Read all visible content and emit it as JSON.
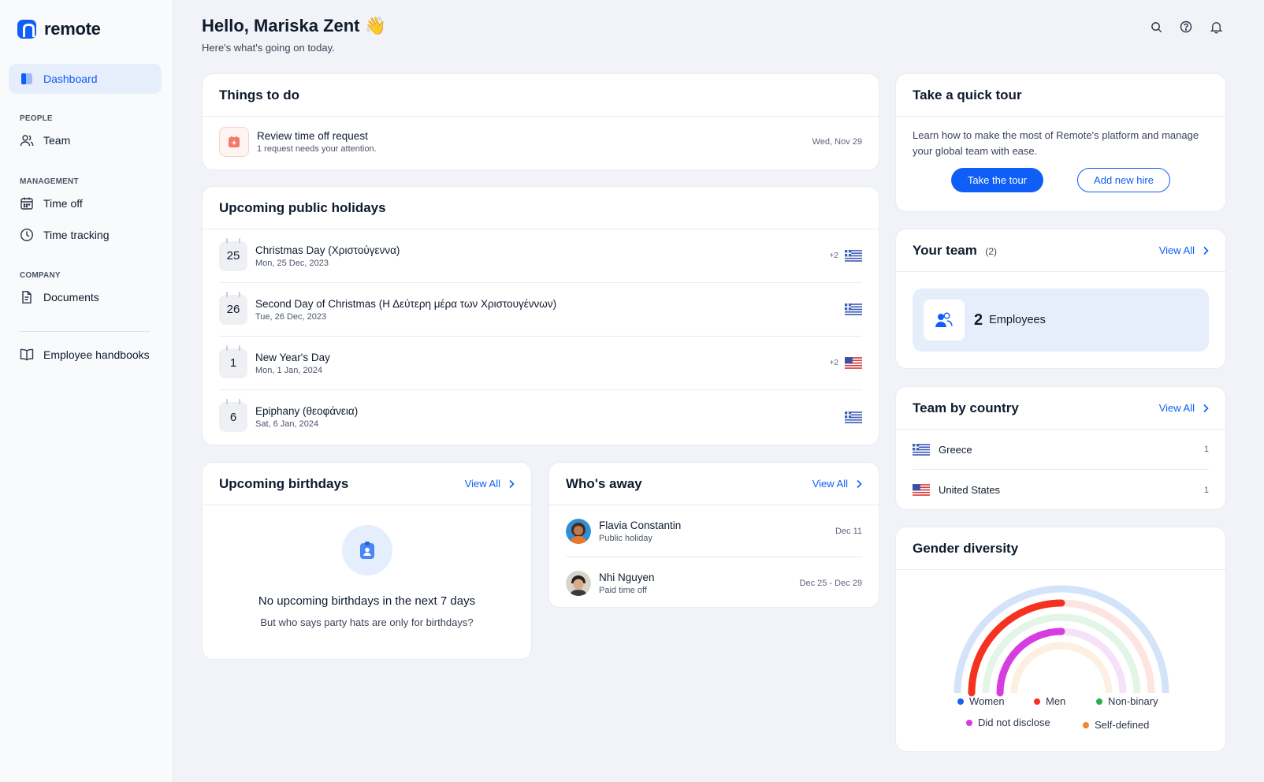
{
  "brand": {
    "name": "remote"
  },
  "sidebar": {
    "dashboard": "Dashboard",
    "sections": {
      "people": "PEOPLE",
      "management": "MANAGEMENT",
      "company": "COMPANY"
    },
    "team": "Team",
    "time_off": "Time off",
    "time_tracking": "Time tracking",
    "documents": "Documents",
    "handbooks": "Employee handbooks"
  },
  "header": {
    "greeting": "Hello, Mariska Zent 👋",
    "subtitle": "Here's what's going on today."
  },
  "todo": {
    "title": "Things to do",
    "items": [
      {
        "title": "Review time off request",
        "subtitle": "1 request needs your attention.",
        "date": "Wed, Nov 29"
      }
    ]
  },
  "holidays": {
    "title": "Upcoming public holidays",
    "items": [
      {
        "day": "25",
        "name": "Christmas Day (Χριστούγεννα)",
        "date": "Mon, 25 Dec, 2023",
        "extra": "+2",
        "flag": "greece"
      },
      {
        "day": "26",
        "name": "Second Day of Christmas (Η Δεύτερη μέρα των Χριστουγέννων)",
        "date": "Tue, 26 Dec, 2023",
        "extra": "",
        "flag": "greece"
      },
      {
        "day": "1",
        "name": "New Year's Day",
        "date": "Mon, 1 Jan, 2024",
        "extra": "+2",
        "flag": "usa"
      },
      {
        "day": "6",
        "name": "Epiphany (θεοφάνεια)",
        "date": "Sat, 6 Jan, 2024",
        "extra": "",
        "flag": "greece"
      }
    ]
  },
  "birthdays": {
    "title": "Upcoming birthdays",
    "view_all": "View All",
    "empty_title": "No upcoming birthdays in the next 7 days",
    "empty_sub": "But who says party hats are only for birthdays?"
  },
  "away": {
    "title": "Who's away",
    "view_all": "View All",
    "items": [
      {
        "name": "Flavia Constantin",
        "reason": "Public holiday",
        "date": "Dec 11"
      },
      {
        "name": "Nhi Nguyen",
        "reason": "Paid time off",
        "date": "Dec 25 - Dec 29"
      }
    ]
  },
  "tour": {
    "title": "Take a quick tour",
    "text": "Learn how to make the most of Remote's platform and manage your global team with ease.",
    "primary": "Take the tour",
    "secondary": "Add new hire"
  },
  "team": {
    "title": "Your team",
    "count_badge": "(2)",
    "view_all": "View All",
    "count": "2",
    "label": "Employees"
  },
  "by_country": {
    "title": "Team by country",
    "view_all": "View All",
    "items": [
      {
        "country": "Greece",
        "count": "1",
        "flag": "greece"
      },
      {
        "country": "United States",
        "count": "1",
        "flag": "usa"
      }
    ]
  },
  "gender": {
    "title": "Gender diversity",
    "legend": [
      {
        "label": "Women",
        "color": "#1a5ff5"
      },
      {
        "label": "Men",
        "color": "#f5321f"
      },
      {
        "label": "Non-binary",
        "color": "#22b24c"
      },
      {
        "label": "Did not disclose",
        "color": "#d63de0"
      },
      {
        "label": "Self-defined",
        "color": "#f4852a"
      }
    ]
  },
  "colors": {
    "accent": "#0f5ef7",
    "background": "#f1f3f8"
  }
}
